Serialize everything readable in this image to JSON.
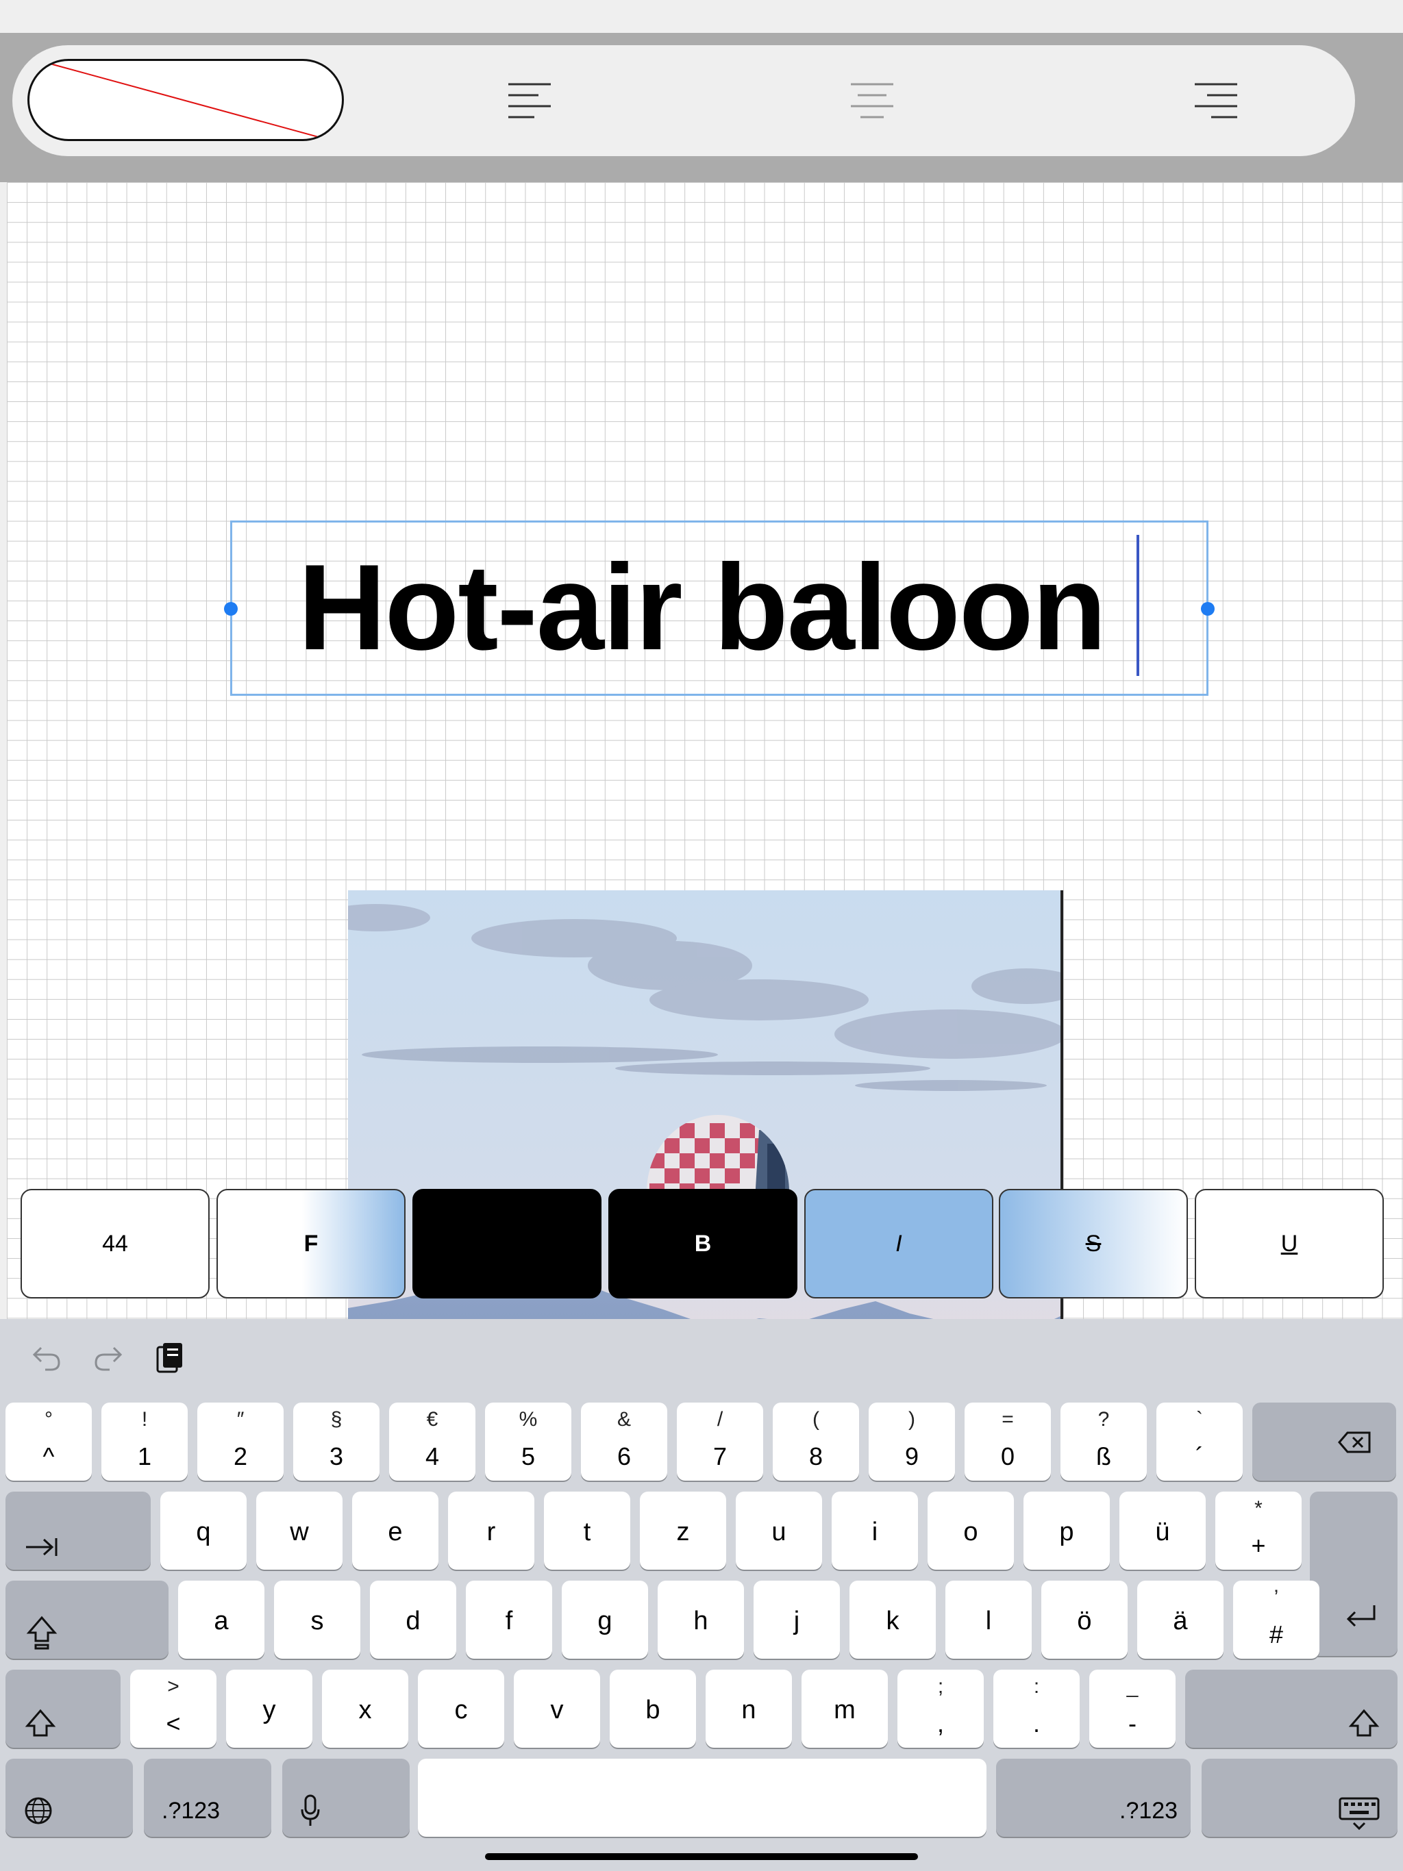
{
  "toolbar": {
    "color_swatch": "none",
    "align_left": "align-left-icon",
    "align_center": "align-center-icon",
    "align_right": "align-right-icon"
  },
  "document": {
    "title_text": "Hot-air baloon"
  },
  "format_bar": {
    "font_size": "44",
    "f_label": "F",
    "black_swatch": "",
    "bold_label": "B",
    "italic_label": "I",
    "strike_label": "S",
    "underline_label": "U"
  },
  "keyboard": {
    "row1": [
      {
        "top": "°",
        "bot": "^"
      },
      {
        "top": "!",
        "bot": "1"
      },
      {
        "top": "″",
        "bot": "2"
      },
      {
        "top": "§",
        "bot": "3"
      },
      {
        "top": "€",
        "bot": "4"
      },
      {
        "top": "%",
        "bot": "5"
      },
      {
        "top": "&",
        "bot": "6"
      },
      {
        "top": "/",
        "bot": "7"
      },
      {
        "top": "(",
        "bot": "8"
      },
      {
        "top": ")",
        "bot": "9"
      },
      {
        "top": "=",
        "bot": "0"
      },
      {
        "top": "?",
        "bot": "ß"
      },
      {
        "top": "`",
        "bot": "´"
      }
    ],
    "row2": [
      "q",
      "w",
      "e",
      "r",
      "t",
      "z",
      "u",
      "i",
      "o",
      "p",
      "ü"
    ],
    "row2_last": {
      "top": "*",
      "bot": "+"
    },
    "row3": [
      "a",
      "s",
      "d",
      "f",
      "g",
      "h",
      "j",
      "k",
      "l",
      "ö",
      "ä"
    ],
    "row3_last": {
      "top": "’",
      "bot": "#"
    },
    "row4_first": {
      "top": ">",
      "bot": "<"
    },
    "row4": [
      "y",
      "x",
      "c",
      "v",
      "b",
      "n",
      "m"
    ],
    "row4_punct": [
      {
        "top": ";",
        "bot": ","
      },
      {
        "top": ":",
        "bot": "."
      },
      {
        "top": "_",
        "bot": "-"
      }
    ],
    "numbers_label_left": ".?123",
    "numbers_label_right": ".?123"
  },
  "colors": {
    "accent": "#1e7cf2",
    "selection_border": "#7fb4ea",
    "format_highlight": "#8fbae6"
  }
}
